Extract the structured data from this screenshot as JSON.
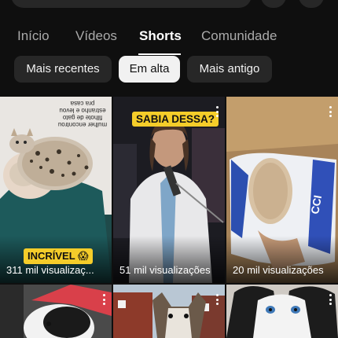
{
  "tabs": [
    {
      "label": "Início",
      "active": false
    },
    {
      "label": "Vídeos",
      "active": false
    },
    {
      "label": "Shorts",
      "active": true
    },
    {
      "label": "Comunidade",
      "active": false
    }
  ],
  "chips": [
    {
      "label": "Mais recentes",
      "active": false
    },
    {
      "label": "Em alta",
      "active": true
    },
    {
      "label": "Mais antigo",
      "active": false
    }
  ],
  "shorts": [
    {
      "views": "311 mil visualizaç...",
      "overlay": "INCRÍVEL 😱",
      "caption": "mulher encontrou filhote de gato estranho e levou pra casa"
    },
    {
      "views": "51 mil visualizações",
      "overlay": "SABIA DESSA?"
    },
    {
      "views": "20 mil visualizações"
    },
    {
      "views": ""
    },
    {
      "views": ""
    },
    {
      "views": ""
    }
  ],
  "icons": {
    "menu": "more-vertical-icon"
  },
  "colors": {
    "background": "#0f0f0f",
    "chip": "#272727",
    "chip_active": "#f1f1f1",
    "overlay_tag": "#f5cd2a"
  }
}
